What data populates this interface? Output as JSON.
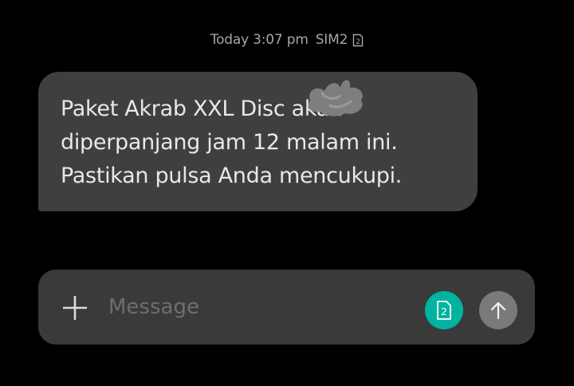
{
  "thread": {
    "timestamp": "Today 3:07 pm",
    "sim_label": "SIM2",
    "sim_number": "2"
  },
  "message": {
    "text": "Paket Akrab XXL Disc       akan\ndiperpanjang jam 12 malam ini.\nPastikan pulsa Anda mencukupi."
  },
  "composer": {
    "placeholder": "Message",
    "value": "",
    "sim_number": "2"
  },
  "icons": {
    "add": "plus-icon",
    "sim": "sim-card-icon",
    "send": "arrow-up-icon"
  },
  "colors": {
    "background": "#000000",
    "bubble": "#3f3f3f",
    "composer": "#3a3a3a",
    "sim_accent": "#00b4a1",
    "send": "#7a7a7a"
  }
}
